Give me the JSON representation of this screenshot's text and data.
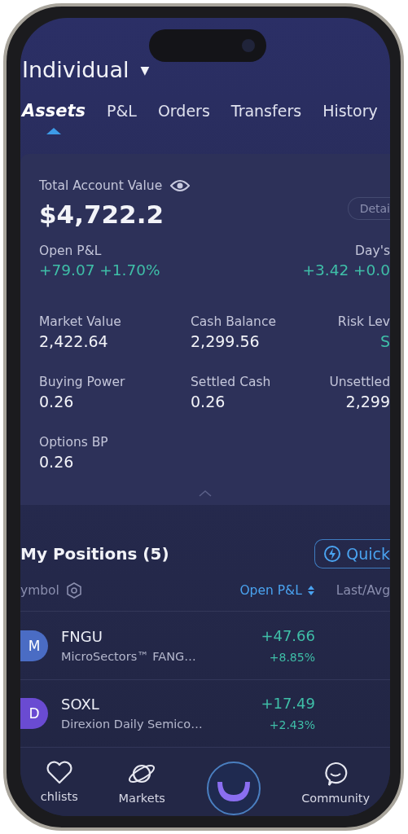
{
  "account": {
    "name": "Individual",
    "caret": "▼"
  },
  "tabs": [
    {
      "label": "Assets",
      "selected": true
    },
    {
      "label": "P&L",
      "selected": false
    },
    {
      "label": "Orders",
      "selected": false
    },
    {
      "label": "Transfers",
      "selected": false
    },
    {
      "label": "History",
      "selected": false
    }
  ],
  "summary": {
    "title": "Total Account Value",
    "value": "$4,722.2",
    "details_button": "Detai",
    "pnl": [
      {
        "label": "Open P&L",
        "value": "+79.07 +1.70%"
      },
      {
        "label": "Day's",
        "value": "+3.42 +0.0"
      }
    ],
    "stats": [
      {
        "label": "Market Value",
        "value": "2,422.64",
        "kind": "plain"
      },
      {
        "label": "Cash Balance",
        "value": "2,299.56",
        "kind": "plain"
      },
      {
        "label": "Risk Lev",
        "value": "S",
        "kind": "status"
      },
      {
        "label": "Buying Power",
        "value": "0.26",
        "kind": "plain"
      },
      {
        "label": "Settled Cash",
        "value": "0.26",
        "kind": "plain"
      },
      {
        "label": "Unsettled",
        "value": "2,299",
        "kind": "plain"
      },
      {
        "label": "Options BP",
        "value": "0.26",
        "kind": "plain"
      }
    ]
  },
  "positions": {
    "title": "My Positions (5)",
    "quick_button": "Quick",
    "columns": [
      {
        "label": "ymbol",
        "selected": false
      },
      {
        "label": "Open P&L",
        "selected": true
      },
      {
        "label": "Last/Avg",
        "selected": false
      }
    ],
    "rows": [
      {
        "avatar": "M",
        "color": "#4a6cc4",
        "symbol": "FNGU",
        "name": "MicroSectors™ FANG…",
        "pnl": "+47.66",
        "pnl_pct": "+8.85%"
      },
      {
        "avatar": "D",
        "color": "#6a4bd2",
        "symbol": "SOXL",
        "name": "Direxion Daily Semico…",
        "pnl": "+17.49",
        "pnl_pct": "+2.43%"
      }
    ]
  },
  "nav": [
    {
      "kind": "heart",
      "label": "chlists"
    },
    {
      "kind": "planet",
      "label": "Markets"
    },
    {
      "kind": "logo"
    },
    {
      "kind": "chat",
      "label": "Community"
    }
  ]
}
